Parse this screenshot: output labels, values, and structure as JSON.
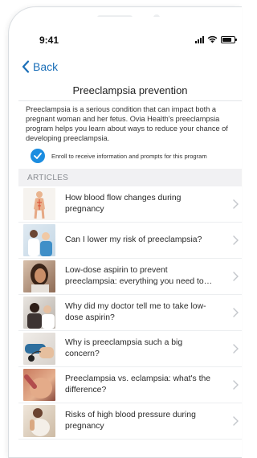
{
  "status_bar": {
    "time": "9:41"
  },
  "nav": {
    "back_label": "Back"
  },
  "page": {
    "title": "Preeclampsia prevention",
    "description": "Preeclampsia is a serious condition that can impact both a pregnant woman and her fetus. Ovia Health's preeclampsia program helps you learn about ways to reduce your chance of developing preeclampsia.",
    "enroll_label": "Enroll to receive information and prompts for this program"
  },
  "articles_section": {
    "header": "ARTICLES",
    "items": [
      {
        "title": "How blood flow changes during pregnancy",
        "thumb": "anatomy-illustration"
      },
      {
        "title": "Can I lower my risk of preeclampsia?",
        "thumb": "doctor-patient-photo"
      },
      {
        "title": "Low-dose aspirin to prevent preeclampsia: everything you need to know",
        "thumb": "woman-photo"
      },
      {
        "title": "Why did my doctor tell me to take low-dose aspirin?",
        "thumb": "doctor-consult-photo"
      },
      {
        "title": "Why is preeclampsia such a big concern?",
        "thumb": "blood-pressure-photo"
      },
      {
        "title": "Preeclampsia vs. eclampsia: what's the difference?",
        "thumb": "pregnant-belly-photo"
      },
      {
        "title": "Risks of high blood pressure during pregnancy",
        "thumb": "pregnant-woman-photo"
      }
    ]
  },
  "colors": {
    "accent": "#1b6fb8",
    "check": "#1c8de0",
    "section_bg": "#f1f1f3"
  }
}
